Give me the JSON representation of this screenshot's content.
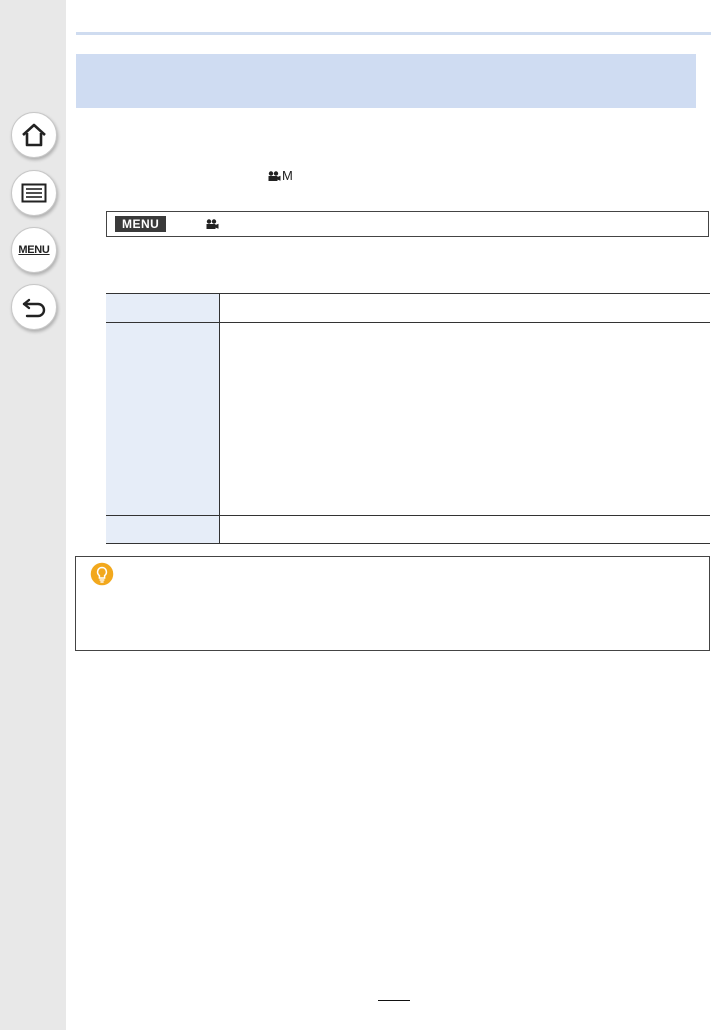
{
  "sidebar": {
    "items": [
      {
        "name": "home",
        "label": ""
      },
      {
        "name": "contents",
        "label": ""
      },
      {
        "name": "menu",
        "label": "MENU"
      },
      {
        "name": "back",
        "label": ""
      }
    ]
  },
  "page": {
    "mode_label": "M",
    "menu_path": {
      "badge": "MENU"
    },
    "table": {
      "rows": [
        {
          "label": "",
          "text": ""
        },
        {
          "label": "",
          "text": ""
        },
        {
          "label": "",
          "text": ""
        }
      ]
    },
    "page_number": ""
  },
  "colors": {
    "sidebar_bg": "#e8e8e8",
    "title_band": "#cfdcf2",
    "table_label_bg": "#e6edf8",
    "tip_icon": "#f2a81d"
  }
}
